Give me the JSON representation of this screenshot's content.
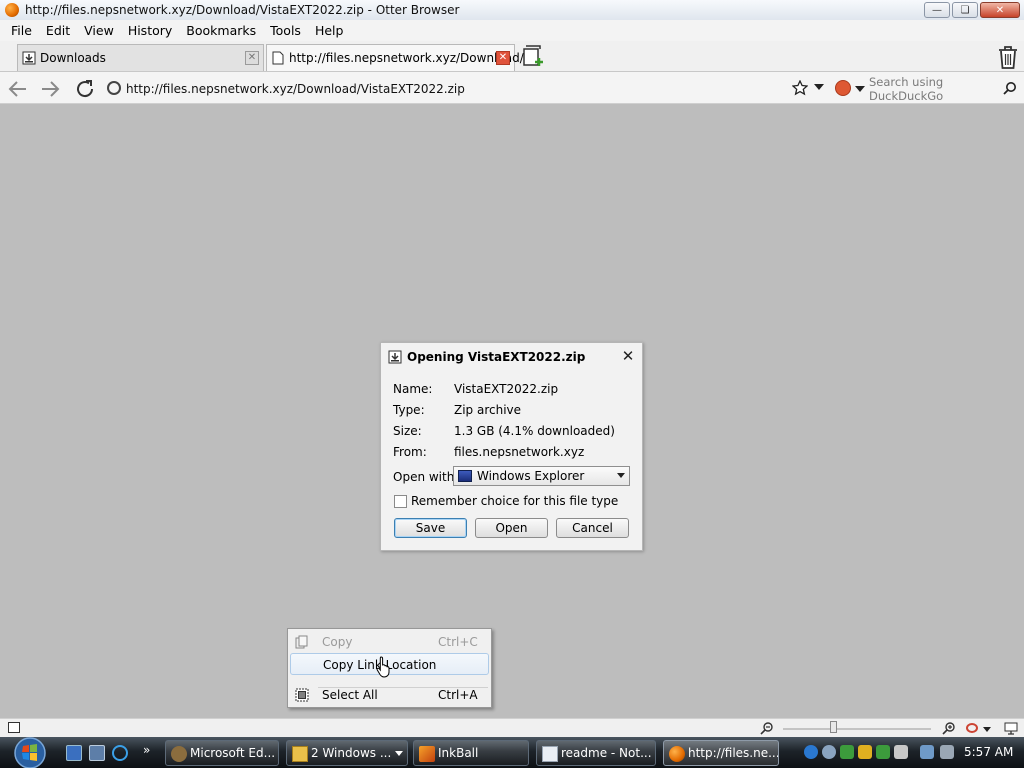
{
  "window": {
    "title": "http://files.nepsnetwork.xyz/Download/VistaEXT2022.zip - Otter Browser"
  },
  "menubar": {
    "items": [
      "File",
      "Edit",
      "View",
      "History",
      "Bookmarks",
      "Tools",
      "Help"
    ]
  },
  "tabs": [
    {
      "label": "Downloads",
      "active": false
    },
    {
      "label": "http://files.nepsnetwork.xyz/Download/...",
      "active": true
    }
  ],
  "navbar": {
    "url": "http://files.nepsnetwork.xyz/Download/VistaEXT2022.zip",
    "search_placeholder": "Search using DuckDuckGo"
  },
  "dialog": {
    "title": "Opening VistaEXT2022.zip",
    "fields": [
      {
        "label": "Name:",
        "value": "VistaEXT2022.zip"
      },
      {
        "label": "Type:",
        "value": "Zip archive"
      },
      {
        "label": "Size:",
        "value": "1.3 GB (4.1% downloaded)"
      },
      {
        "label": "From:",
        "value": "files.nepsnetwork.xyz"
      }
    ],
    "open_with_label": "Open with:",
    "open_with_value": "Windows Explorer",
    "remember_label": "Remember choice for this file type",
    "remember_checked": false,
    "buttons": {
      "save": "Save",
      "open": "Open",
      "cancel": "Cancel"
    }
  },
  "context_menu": {
    "items": [
      {
        "label": "Copy",
        "shortcut": "Ctrl+C",
        "enabled": false
      },
      {
        "label": "Copy Link Location",
        "shortcut": "",
        "enabled": true
      },
      {
        "label": "Select All",
        "shortcut": "Ctrl+A",
        "enabled": true
      }
    ]
  },
  "taskbar": {
    "buttons": [
      {
        "label": "Microsoft Ed..."
      },
      {
        "label": "2 Windows ..."
      },
      {
        "label": "InkBall"
      },
      {
        "label": "readme - Not..."
      },
      {
        "label": "http://files.ne..."
      }
    ],
    "clock": "5:57 AM"
  },
  "colors": {
    "page_background": "#bdbdbd",
    "taskbar": "#1d2329",
    "close_button": "#c6432a"
  }
}
